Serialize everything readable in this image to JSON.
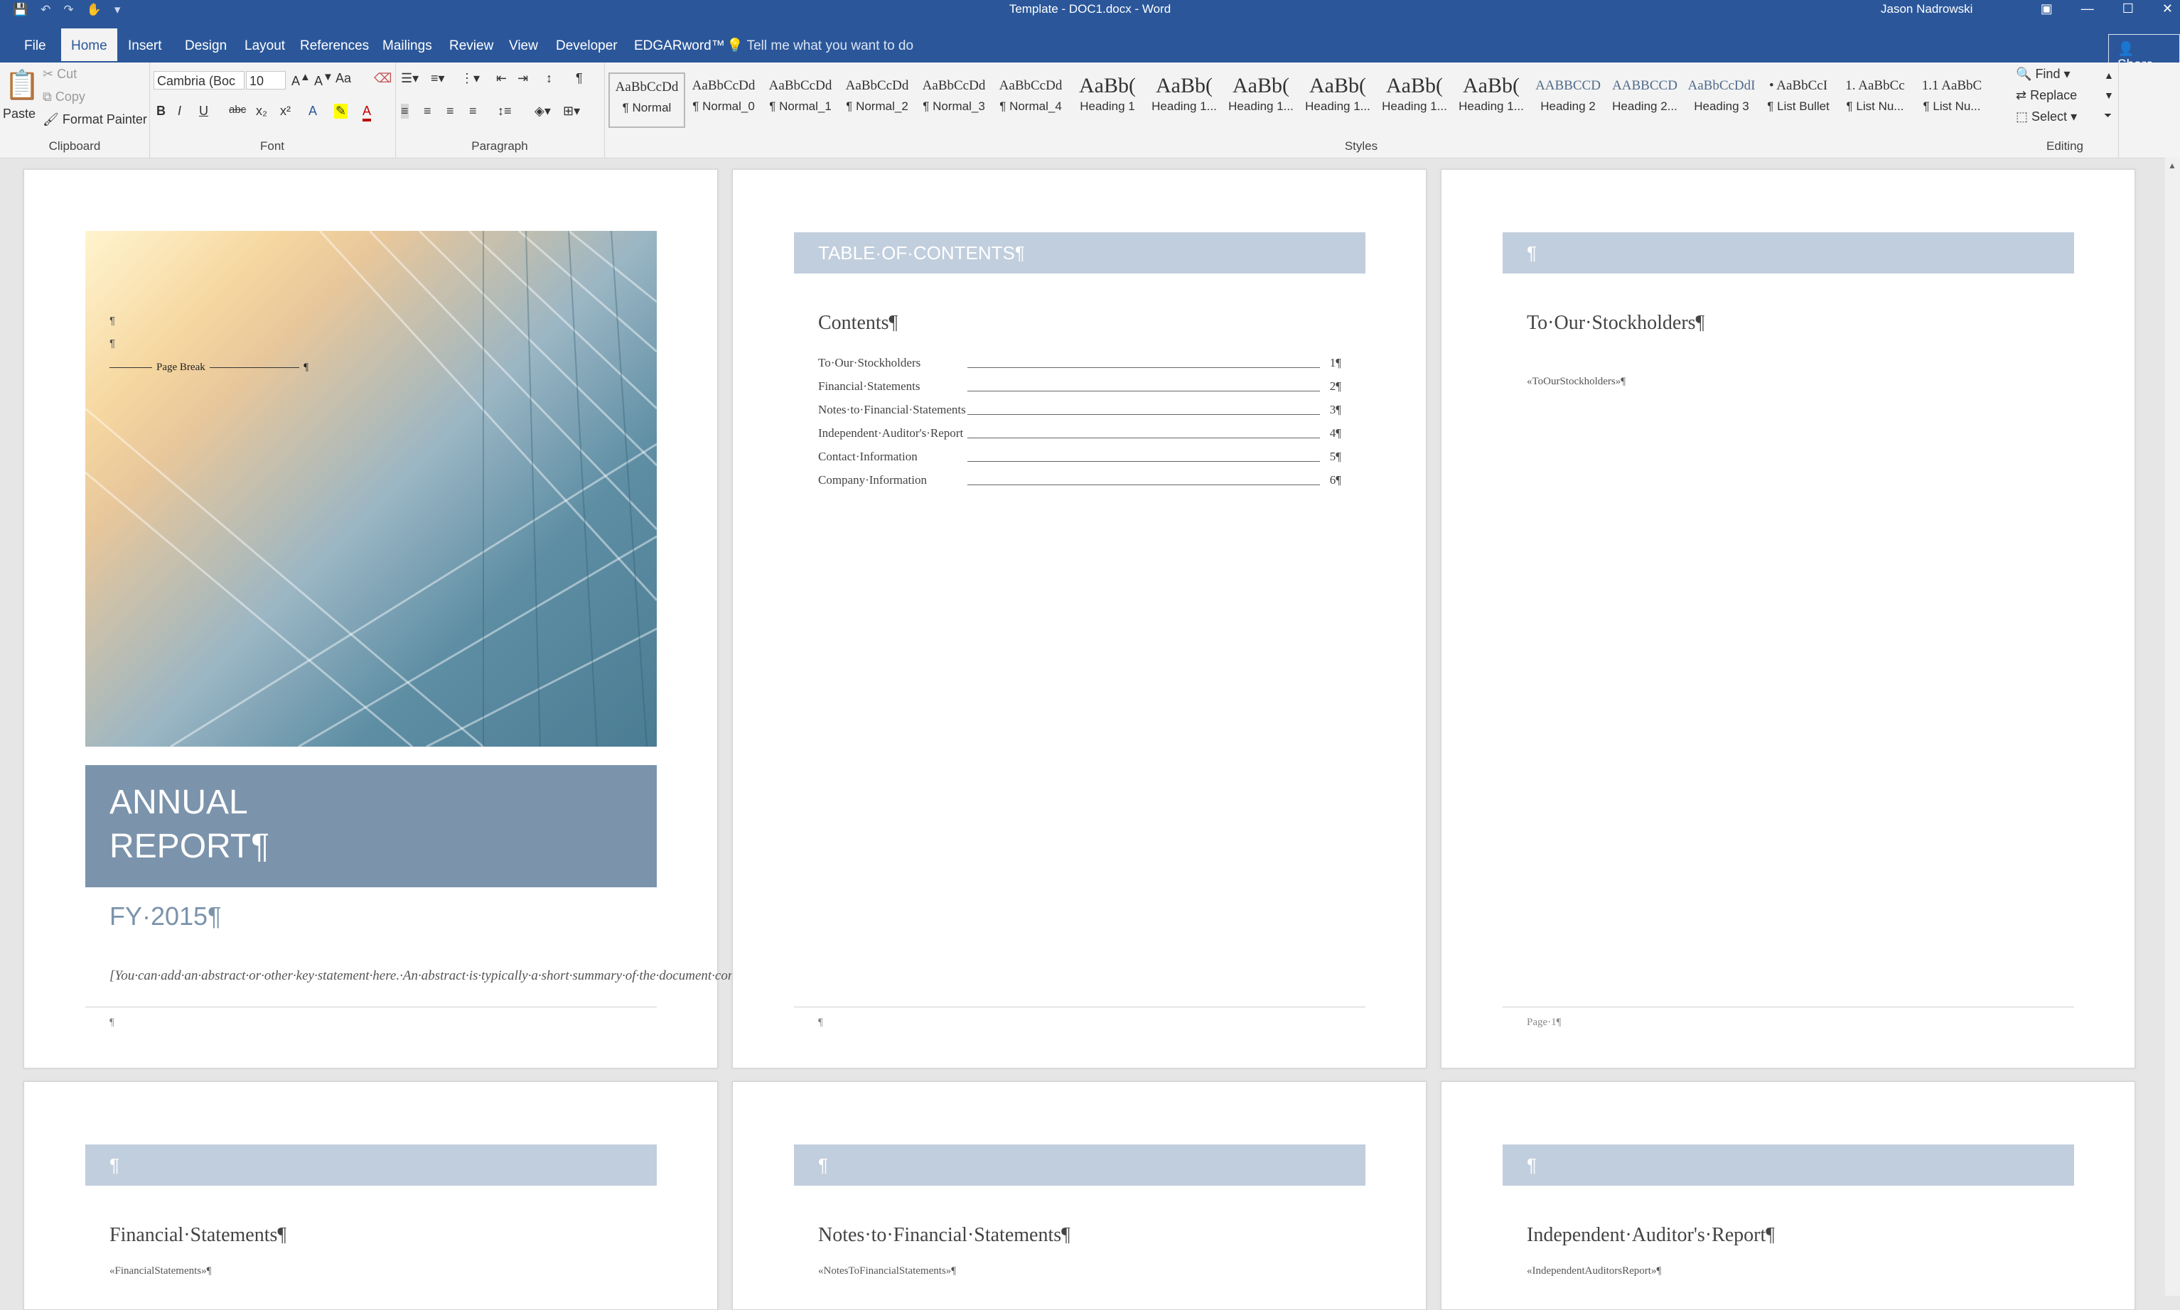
{
  "window": {
    "title": "Template - DOC1.docx  -  Word",
    "user": "Jason Nadrowski",
    "share_label": "Share",
    "tell_me_placeholder": "Tell me what you want to do"
  },
  "tabs": [
    "File",
    "Home",
    "Insert",
    "Design",
    "Layout",
    "References",
    "Mailings",
    "Review",
    "View",
    "Developer",
    "EDGARword™"
  ],
  "active_tab": "Home",
  "ribbon": {
    "clipboard": {
      "paste": "Paste",
      "cut": "Cut",
      "copy": "Copy",
      "format_painter": "Format Painter",
      "label": "Clipboard"
    },
    "font": {
      "name": "Cambria (Boc",
      "size": "10",
      "label": "Font",
      "b": "B",
      "i": "I",
      "u": "U",
      "strike": "abc",
      "sub": "x₂",
      "sup": "x²",
      "aa": "Aa"
    },
    "paragraph": {
      "label": "Paragraph"
    },
    "styles": {
      "label": "Styles",
      "items": [
        {
          "preview": "AaBbCcDd",
          "name": "¶ Normal"
        },
        {
          "preview": "AaBbCcDd",
          "name": "¶ Normal_0"
        },
        {
          "preview": "AaBbCcDd",
          "name": "¶ Normal_1"
        },
        {
          "preview": "AaBbCcDd",
          "name": "¶ Normal_2"
        },
        {
          "preview": "AaBbCcDd",
          "name": "¶ Normal_3"
        },
        {
          "preview": "AaBbCcDd",
          "name": "¶ Normal_4"
        },
        {
          "preview": "AaBb(",
          "name": "Heading 1"
        },
        {
          "preview": "AaBb(",
          "name": "Heading 1..."
        },
        {
          "preview": "AaBb(",
          "name": "Heading 1..."
        },
        {
          "preview": "AaBb(",
          "name": "Heading 1..."
        },
        {
          "preview": "AaBb(",
          "name": "Heading 1..."
        },
        {
          "preview": "AaBb(",
          "name": "Heading 1..."
        },
        {
          "preview": "AABBCCD",
          "name": "Heading 2"
        },
        {
          "preview": "AABBCCD",
          "name": "Heading 2..."
        },
        {
          "preview": "AaBbCcDdI",
          "name": "Heading 3"
        },
        {
          "preview": "• AaBbCcI",
          "name": "¶ List Bullet"
        },
        {
          "preview": "1. AaBbCc",
          "name": "¶ List Nu..."
        },
        {
          "preview": "1.1 AaBbC",
          "name": "¶ List Nu..."
        }
      ]
    },
    "editing": {
      "find": "Find",
      "replace": "Replace",
      "select": "Select",
      "label": "Editing"
    }
  },
  "pages": {
    "cover": {
      "page_break": "Page Break",
      "title_line1": "ANNUAL",
      "title_line2": "REPORT¶",
      "fy": "FY·2015¶",
      "abstract": "[You·can·add·an·abstract·or·other·key·statement·here.·An·abstract·is·typically·a·short·summary·of·the·document·content.]¶",
      "footer": "¶"
    },
    "toc": {
      "band": "TABLE·OF·CONTENTS¶",
      "heading": "Contents¶",
      "entries": [
        {
          "label": "To·Our·Stockholders",
          "page": "1¶"
        },
        {
          "label": "Financial·Statements",
          "page": "2¶"
        },
        {
          "label": "Notes·to·Financial·Statements",
          "page": "3¶"
        },
        {
          "label": "Independent·Auditor's·Report",
          "page": "4¶"
        },
        {
          "label": "Contact·Information",
          "page": "5¶"
        },
        {
          "label": "Company·Information",
          "page": "6¶"
        }
      ],
      "footer": "¶"
    },
    "stockholders": {
      "band": "¶",
      "heading": "To·Our·Stockholders¶",
      "merge": "«ToOurStockholders»¶",
      "footer": "Page·1¶"
    },
    "financial": {
      "band": "¶",
      "heading": "Financial·Statements¶",
      "merge": "«FinancialStatements»¶"
    },
    "notes": {
      "band": "¶",
      "heading": "Notes·to·Financial·Statements¶",
      "merge": "«NotesToFinancialStatements»¶"
    },
    "auditor": {
      "band": "¶",
      "heading": "Independent·Auditor's·Report¶",
      "merge": "«IndependentAuditorsReport»¶"
    }
  }
}
